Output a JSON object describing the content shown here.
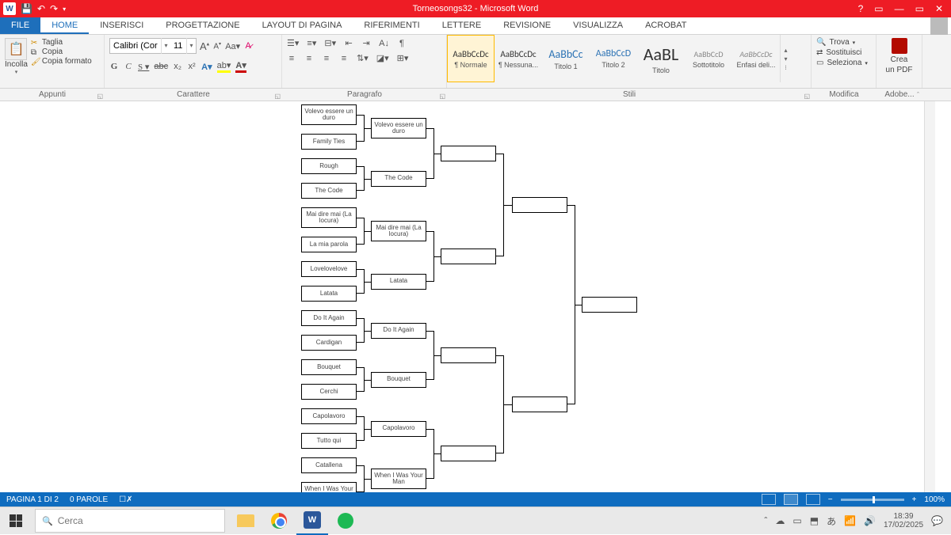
{
  "titlebar": {
    "title": "Torneosongs32 - Microsoft Word",
    "help": "?",
    "ribbonopts": "▭",
    "min": "—",
    "max": "▭",
    "close": "✕"
  },
  "tabs": {
    "file": "FILE",
    "home": "HOME",
    "inserisci": "INSERISCI",
    "progettazione": "PROGETTAZIONE",
    "layout": "LAYOUT DI PAGINA",
    "riferimenti": "RIFERIMENTI",
    "lettere": "LETTERE",
    "revisione": "REVISIONE",
    "visualizza": "VISUALIZZA",
    "acrobat": "ACROBAT"
  },
  "ribbon": {
    "clipboard": {
      "paste": "Incolla",
      "taglia": "Taglia",
      "copia": "Copia",
      "copiafmt": "Copia formato",
      "label": "Appunti"
    },
    "font": {
      "name": "Calibri (Corp",
      "size": "11",
      "label": "Carattere"
    },
    "paragraph": {
      "label": "Paragrafo"
    },
    "styles": {
      "label": "Stili",
      "items": [
        {
          "preview": "AaBbCcDc",
          "name": "¶ Normale",
          "size": "11px",
          "color": "#333"
        },
        {
          "preview": "AaBbCcDc",
          "name": "¶ Nessuna...",
          "size": "11px",
          "color": "#333"
        },
        {
          "preview": "AaBbCc",
          "name": "Titolo 1",
          "size": "14px",
          "color": "#2e74b5"
        },
        {
          "preview": "AaBbCcD",
          "name": "Titolo 2",
          "size": "12px",
          "color": "#2e74b5"
        },
        {
          "preview": "AaBL",
          "name": "Titolo",
          "size": "22px",
          "color": "#333"
        },
        {
          "preview": "AaBbCcD",
          "name": "Sottotitolo",
          "size": "10px",
          "color": "#888"
        },
        {
          "preview": "AaBbCcDc",
          "name": "Enfasi deli...",
          "size": "10px",
          "color": "#888",
          "style": "italic"
        }
      ]
    },
    "editing": {
      "trova": "Trova",
      "sostituisci": "Sostituisci",
      "seleziona": "Seleziona",
      "label": "Modifica"
    },
    "adobe": {
      "crea": "Crea",
      "unpdf": "un PDF",
      "label": "Adobe..."
    }
  },
  "bracket": {
    "round1": [
      "Volevo essere un duro",
      "Family Ties",
      "Rough",
      "The Code",
      "Mai dire mai (La locura)",
      "La mia parola",
      "Lovelovelove",
      "Latata",
      "Do It Again",
      "Cardigan",
      "Bouquet",
      "Cerchi",
      "Capolavoro",
      "Tutto qui",
      "Catallena",
      "When I Was Your Man"
    ],
    "round2": [
      "Volevo essere un duro",
      "The Code",
      "Mai dire mai (La locura)",
      "Latata",
      "Do It Again",
      "Bouquet",
      "Capolavoro",
      "When I Was Your Man"
    ],
    "round3": [
      "",
      "",
      "",
      ""
    ],
    "round4": [
      "",
      ""
    ],
    "round5": [
      ""
    ]
  },
  "statusbar": {
    "page": "PAGINA 1 DI 2",
    "words": "0 PAROLE",
    "zoom": "100%"
  },
  "taskbar": {
    "search_placeholder": "Cerca",
    "time": "18:39",
    "date": "17/02/2025"
  }
}
